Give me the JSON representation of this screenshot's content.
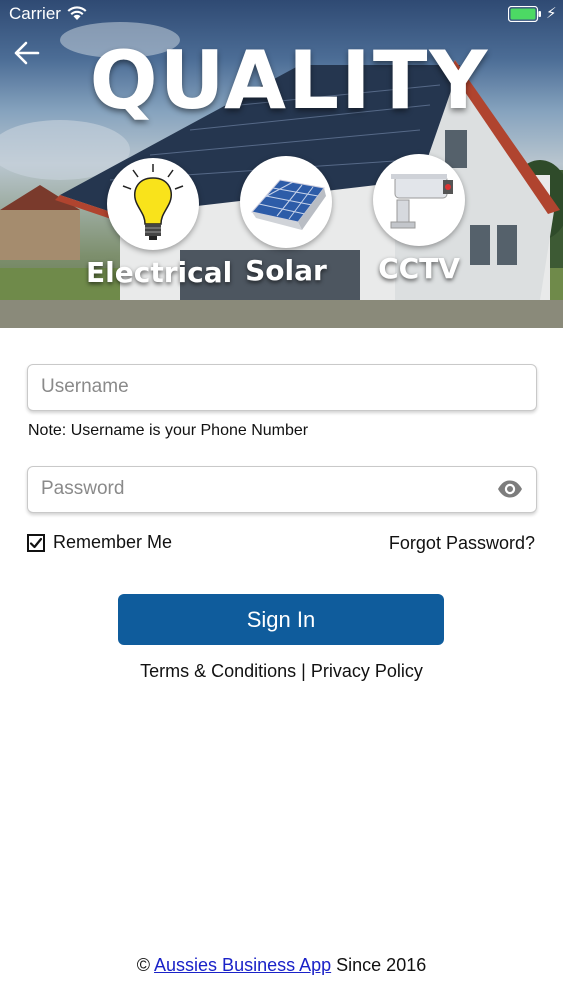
{
  "status_bar": {
    "carrier": "Carrier"
  },
  "hero": {
    "title": "QUALITY",
    "services": [
      {
        "label": "Electrical",
        "icon": "lightbulb-icon"
      },
      {
        "label": "Solar",
        "icon": "solar-panel-icon"
      },
      {
        "label": "CCTV",
        "icon": "security-camera-icon"
      }
    ]
  },
  "login": {
    "username_placeholder": "Username",
    "username_value": "",
    "username_note": "Note: Username is your Phone Number",
    "password_placeholder": "Password",
    "password_value": "",
    "remember_me_label": "Remember Me",
    "remember_me_checked": true,
    "forgot_password_label": "Forgot Password?",
    "sign_in_label": "Sign In"
  },
  "legal": {
    "terms_label": "Terms & Conditions",
    "separator": " | ",
    "privacy_label": "Privacy Policy"
  },
  "footer": {
    "copyright_symbol": "©",
    "app_link_label": "Aussies Business App",
    "since_text": "Since 2016"
  },
  "colors": {
    "primary_button": "#0f5c9c",
    "link": "#1a22c8",
    "battery": "#4cd964"
  }
}
